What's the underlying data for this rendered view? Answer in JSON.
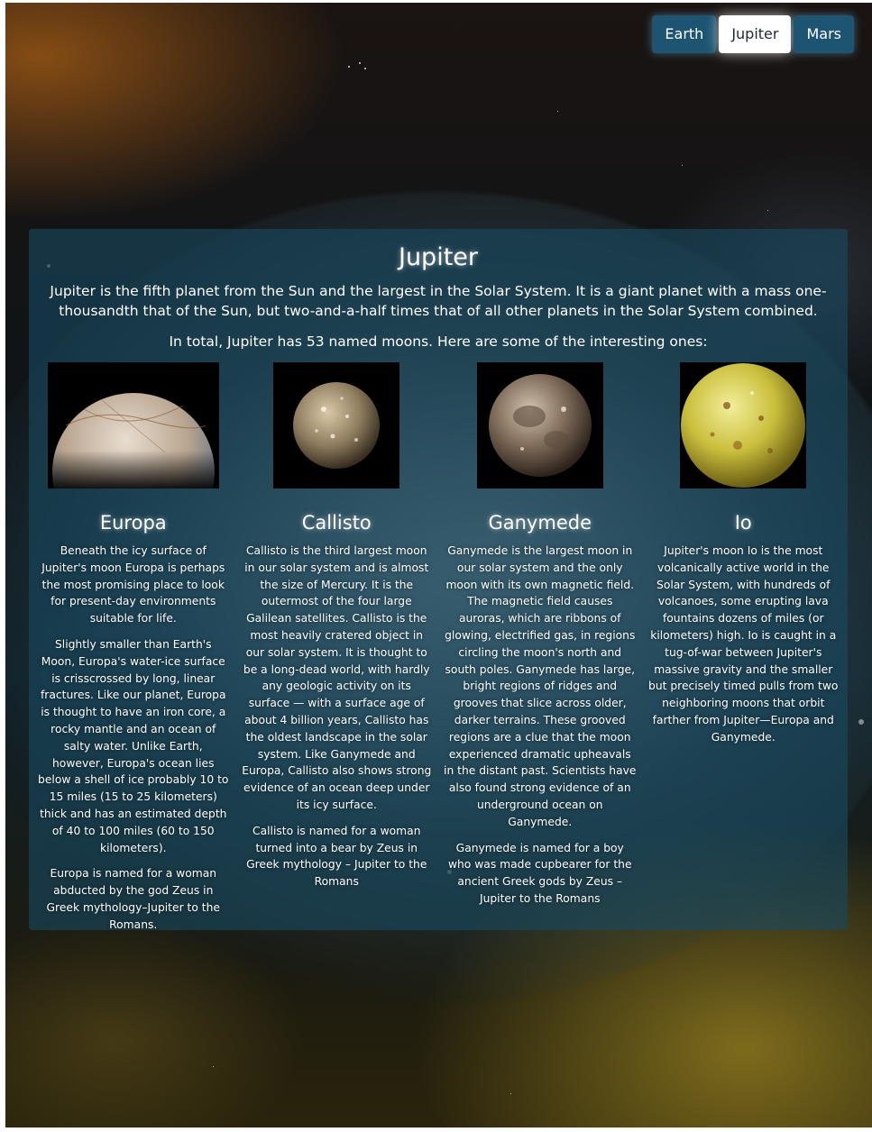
{
  "nav": {
    "items": [
      "Earth",
      "Jupiter",
      "Mars"
    ],
    "active": "Jupiter"
  },
  "planet": {
    "title": "Jupiter",
    "intro": "Jupiter is the fifth planet from the Sun and the largest in the Solar System. It is a giant planet with a mass one-thousandth that of the Sun, but two-and-a-half times that of all other planets in the Solar System combined.",
    "moons_intro": "In total, Jupiter has 53 named moons. Here are some of the interesting ones:"
  },
  "moons": [
    {
      "name": "Europa",
      "image": "europa-image",
      "paragraphs": [
        "Beneath the icy surface of Jupiter's moon Europa is perhaps the most promising place to look for present-day environments suitable for life.",
        "Slightly smaller than Earth's Moon, Europa's water-ice surface is crisscrossed by long, linear fractures. Like our planet, Europa is thought to have an iron core, a rocky mantle and an ocean of salty water. Unlike Earth, however, Europa's ocean lies below a shell of ice probably 10 to 15 miles (15 to 25 kilometers) thick and has an estimated depth of 40 to 100 miles (60 to 150 kilometers).",
        "Europa is named for a woman abducted by the god Zeus in Greek mythology–Jupiter to the Romans."
      ]
    },
    {
      "name": "Callisto",
      "image": "callisto-image",
      "paragraphs": [
        "Callisto is the third largest moon in our solar system and is almost the size of Mercury. It is the outermost of the four large Galilean satellites. Callisto is the most heavily cratered object in our solar system. It is thought to be a long-dead world, with hardly any geologic activity on its surface — with a surface age of about 4 billion years, Callisto has the oldest landscape in the solar system. Like Ganymede and Europa, Callisto also shows strong evidence of an ocean deep under its icy surface.",
        "Callisto is named for a woman turned into a bear by Zeus in Greek mythology – Jupiter to the Romans"
      ]
    },
    {
      "name": "Ganymede",
      "image": "ganymede-image",
      "paragraphs": [
        "Ganymede is the largest moon in our solar system and the only moon with its own magnetic field. The magnetic field causes auroras, which are ribbons of glowing, electrified gas, in regions circling the moon's north and south poles. Ganymede has large, bright regions of ridges and grooves that slice across older, darker terrains. These grooved regions are a clue that the moon experienced dramatic upheavals in the distant past. Scientists have also found strong evidence of an underground ocean on Ganymede.",
        "Ganymede is named for a boy who was made cupbearer for the ancient Greek gods by Zeus – Jupiter to the Romans"
      ]
    },
    {
      "name": "Io",
      "image": "io-image",
      "paragraphs": [
        "Jupiter's moon Io is the most volcanically active world in the Solar System, with hundreds of volcanoes, some erupting lava fountains dozens of miles (or kilometers) high. Io is caught in a tug-of-war between Jupiter's massive gravity and the smaller but precisely timed pulls from two neighboring moons that orbit farther from Jupiter—Europa and Ganymede."
      ]
    }
  ]
}
